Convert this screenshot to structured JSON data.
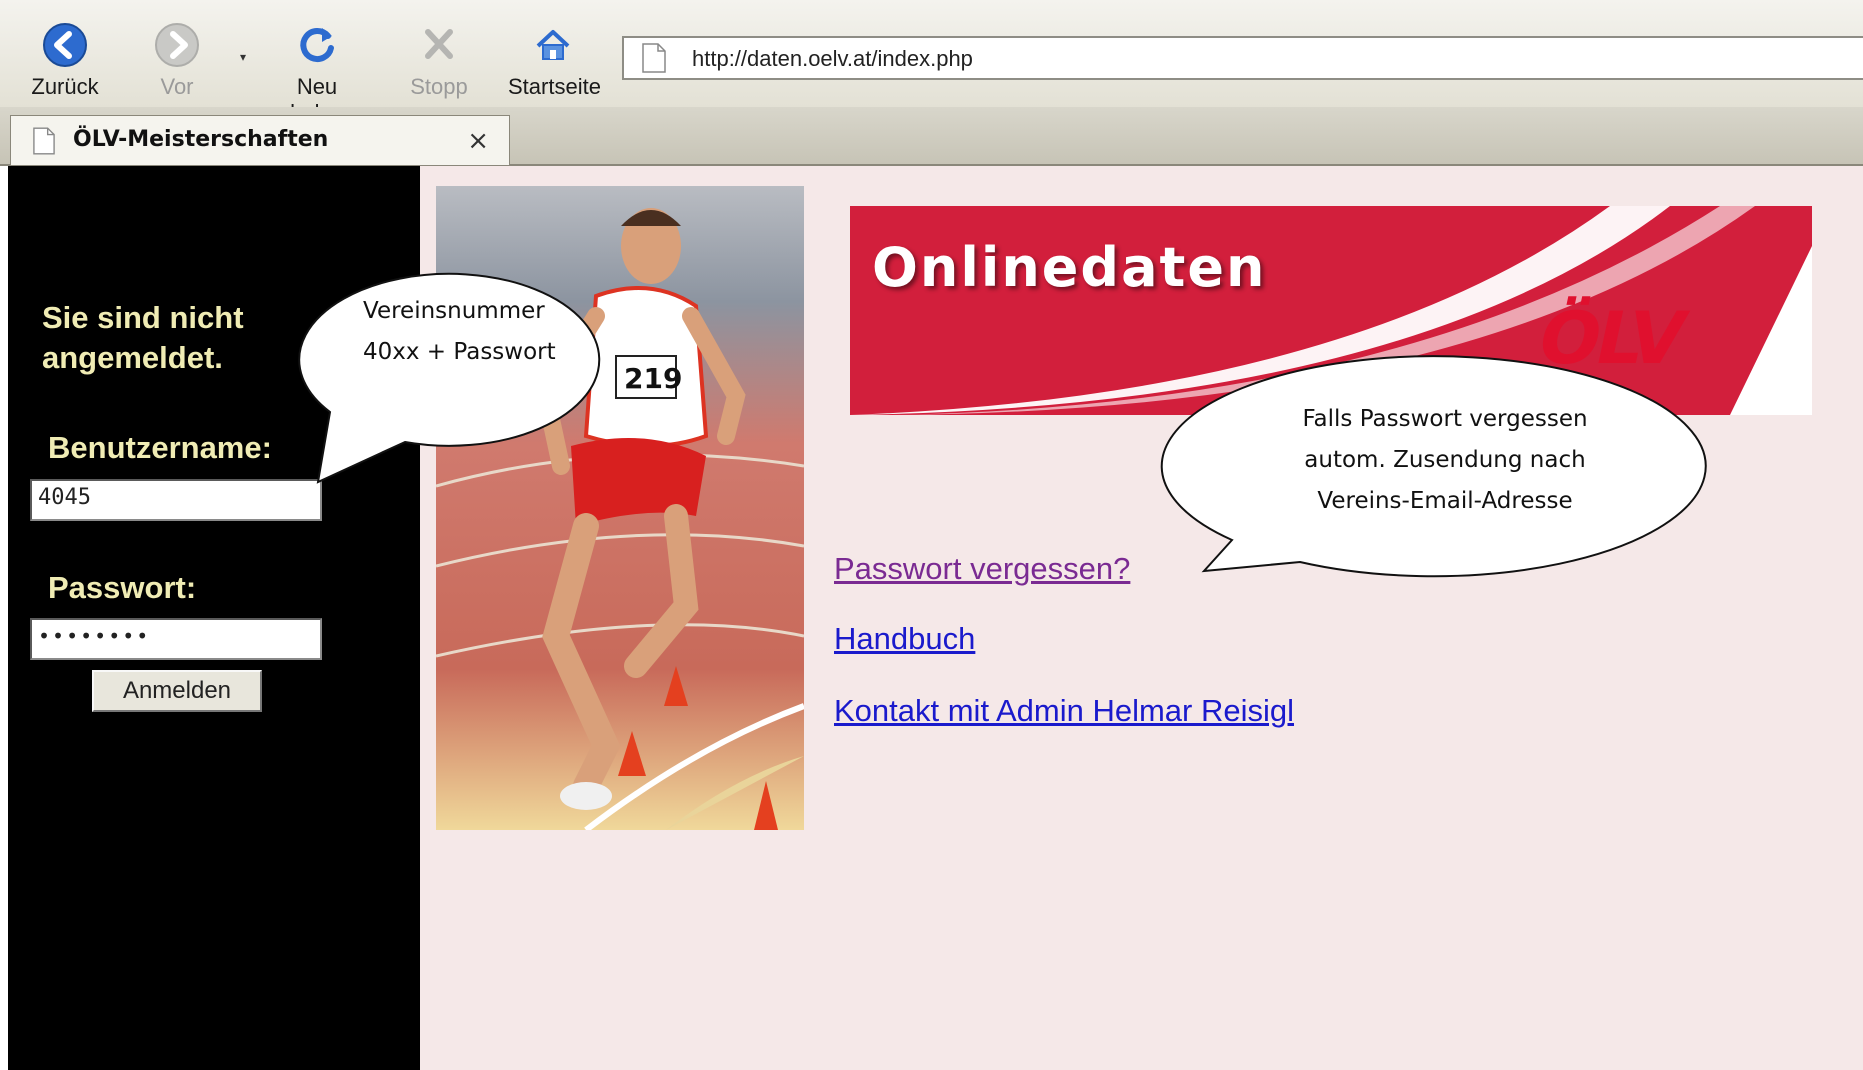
{
  "browser": {
    "buttons": {
      "back": "Zurück",
      "forward": "Vor",
      "reload": "Neu laden",
      "stop": "Stopp",
      "home": "Startseite"
    },
    "url": "http://daten.oelv.at/index.php",
    "tab_title": "ÖLV-Meisterschaften",
    "tab_close": "×"
  },
  "sidebar": {
    "status_line1": "Sie sind nicht",
    "status_line2": "angemeldet.",
    "username_label": "Benutzername:",
    "username_value": "4045",
    "password_label": "Passwort:",
    "password_value": "••••••••",
    "login_button": "Anmelden"
  },
  "main": {
    "banner_title": "Onlinedaten",
    "banner_logo": "ÖLV",
    "runner_bib": "219",
    "links": {
      "forgot_password": "Passwort vergessen?",
      "manual": "Handbuch",
      "contact": "Kontakt mit Admin Helmar Reisigl"
    }
  },
  "callouts": {
    "login_hint_line1": "Vereinsnummer",
    "login_hint_line2": "40xx + Passwort",
    "password_hint_line1": "Falls Passwort vergessen",
    "password_hint_line2": "autom. Zusendung nach",
    "password_hint_line3": "Vereins-Email-Adresse"
  },
  "colors": {
    "sidebar_bg": "#000000",
    "sidebar_text": "#f0ecb4",
    "page_bg": "#f5e8e8",
    "banner_red": "#d21f3c",
    "link_blue": "#1a1acc",
    "link_visited": "#7a2a92"
  },
  "icons": [
    "back-arrow-icon",
    "forward-arrow-icon",
    "reload-icon",
    "stop-icon",
    "home-icon",
    "page-icon",
    "close-icon"
  ]
}
